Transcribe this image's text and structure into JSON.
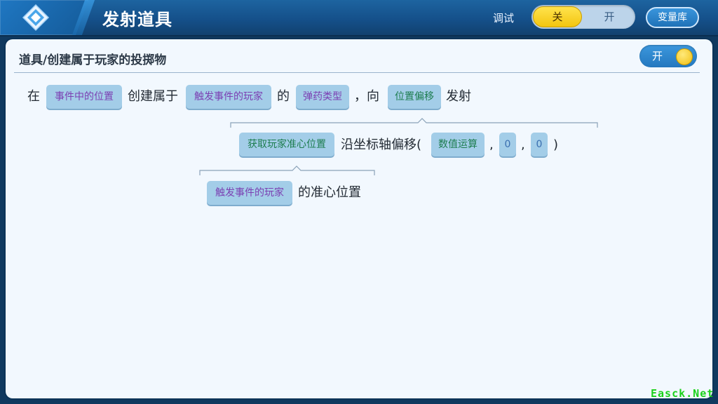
{
  "header": {
    "title": "发射道具",
    "debug": {
      "label": "调试",
      "off": "关",
      "on": "开",
      "selected": "关"
    },
    "variable_library": "变量库"
  },
  "panel": {
    "title": "道具/创建属于玩家的投掷物",
    "enabled_label": "开",
    "enabled": true
  },
  "statement": {
    "w1": "在",
    "p1": "事件中的位置",
    "w2": "创建属于",
    "p2": "触发事件的玩家",
    "w3": "的",
    "p3": "弹药类型",
    "w4": "，向",
    "p4": "位置偏移",
    "w5": "发射"
  },
  "offset_expr": {
    "p1": "获取玩家准心位置",
    "w1": "沿坐标轴偏移(",
    "p2": "数值运算",
    "sep1": ",",
    "v1": "0",
    "sep2": ",",
    "v2": "0",
    "close": ")"
  },
  "crosshair_expr": {
    "p1": "触发事件的玩家",
    "w1": "的准心位置"
  },
  "watermark": "Easck.Net",
  "colors": {
    "header": "#15508a",
    "panel": "#f2f8fe",
    "chip": "#a3cde8",
    "toggle_active": "#f3c50f",
    "param_purple": "#7b3fb2",
    "param_green": "#1d7d4f",
    "watermark": "#1bd11b"
  }
}
